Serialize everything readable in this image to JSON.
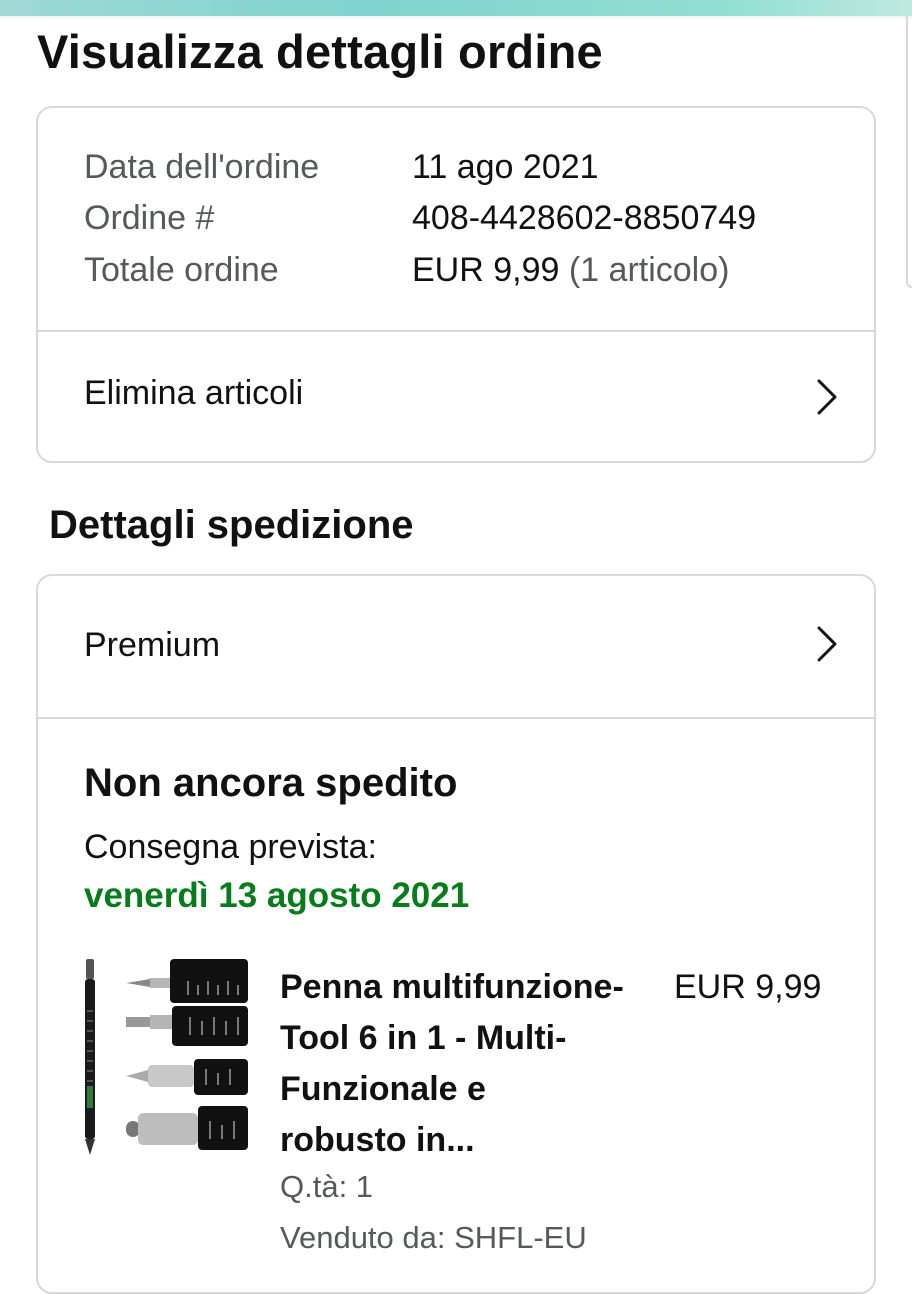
{
  "page": {
    "title": "Visualizza dettagli ordine"
  },
  "order_summary": {
    "rows": [
      {
        "label": "Data dell'ordine",
        "value": "11 ago 2021",
        "suffix": ""
      },
      {
        "label": "Ordine #",
        "value": "408-4428602-8850749",
        "suffix": ""
      },
      {
        "label": "Totale ordine",
        "value": "EUR 9,99",
        "suffix": " (1 articolo)"
      }
    ],
    "action": {
      "label": "Elimina articoli",
      "icon": "chevron-right-icon"
    }
  },
  "shipping": {
    "section_title": "Dettagli spedizione",
    "method": {
      "label": "Premium",
      "icon": "chevron-right-icon"
    },
    "status": "Non ancora spedito",
    "delivery_label": "Consegna prevista:",
    "delivery_date": "venerdì 13 agosto 2021",
    "colors": {
      "delivery_date": "#067d1a"
    }
  },
  "item": {
    "title_lines": [
      "Penna multifunzione-",
      "Tool 6 in 1 - Multi-",
      "Funzionale e",
      "robusto in..."
    ],
    "price": "EUR 9,99",
    "quantity": "Q.tà: 1",
    "seller": "Venduto da: SHFL-EU",
    "image_icon": "multitool-pen-product-image"
  }
}
